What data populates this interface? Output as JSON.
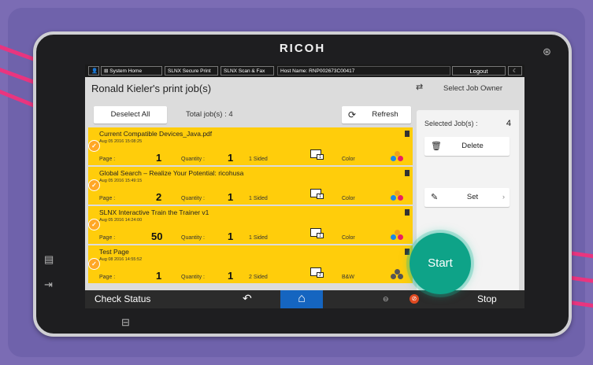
{
  "device": {
    "brand": "RICOH"
  },
  "topbar": {
    "system_home": "System Home",
    "secure_print": "SLNX Secure Print",
    "scan_fax": "SLNX Scan & Fax",
    "host_name": "Host Name: RNP002673C00417",
    "logout": "Logout"
  },
  "header": {
    "title": "Ronald Kieler's print job(s)",
    "select_owner": "Select Job Owner"
  },
  "toolbar": {
    "deselect_all": "Deselect All",
    "total_jobs": "Total job(s) : 4",
    "refresh": "Refresh"
  },
  "jobs": [
    {
      "name": "Current Compatible Devices_Java.pdf",
      "date": "Aug 05 2016 15:08:25",
      "page_label": "Page :",
      "pages": "1",
      "qty_label": "Quantity :",
      "quantity": "1",
      "sides": "1 Sided",
      "color": "Color"
    },
    {
      "name": "Global Search – Realize Your Potential: ricohusa",
      "date": "Aug 05 2016 15:49:15",
      "page_label": "Page :",
      "pages": "2",
      "qty_label": "Quantity :",
      "quantity": "1",
      "sides": "1 Sided",
      "color": "Color"
    },
    {
      "name": "SLNX Interactive Train the Trainer v1",
      "date": "Aug 05 2016 14:24:00",
      "page_label": "Page :",
      "pages": "50",
      "qty_label": "Quantity :",
      "quantity": "1",
      "sides": "1 Sided",
      "color": "Color"
    },
    {
      "name": "Test Page",
      "date": "Aug 08 2016 14:55:52",
      "page_label": "Page :",
      "pages": "1",
      "qty_label": "Quantity :",
      "quantity": "1",
      "sides": "2 Sided",
      "color": "B&W"
    }
  ],
  "panel": {
    "selected_label": "Selected Job(s) :",
    "selected_count": "4",
    "delete": "Delete",
    "set": "Set",
    "start": "Start"
  },
  "bottombar": {
    "check_status": "Check Status",
    "stop": "Stop"
  },
  "colors": {
    "job_row": "#ffcd0b",
    "start": "#0ea388",
    "home_tile": "#1565c0",
    "background": "#7b6cb4"
  }
}
